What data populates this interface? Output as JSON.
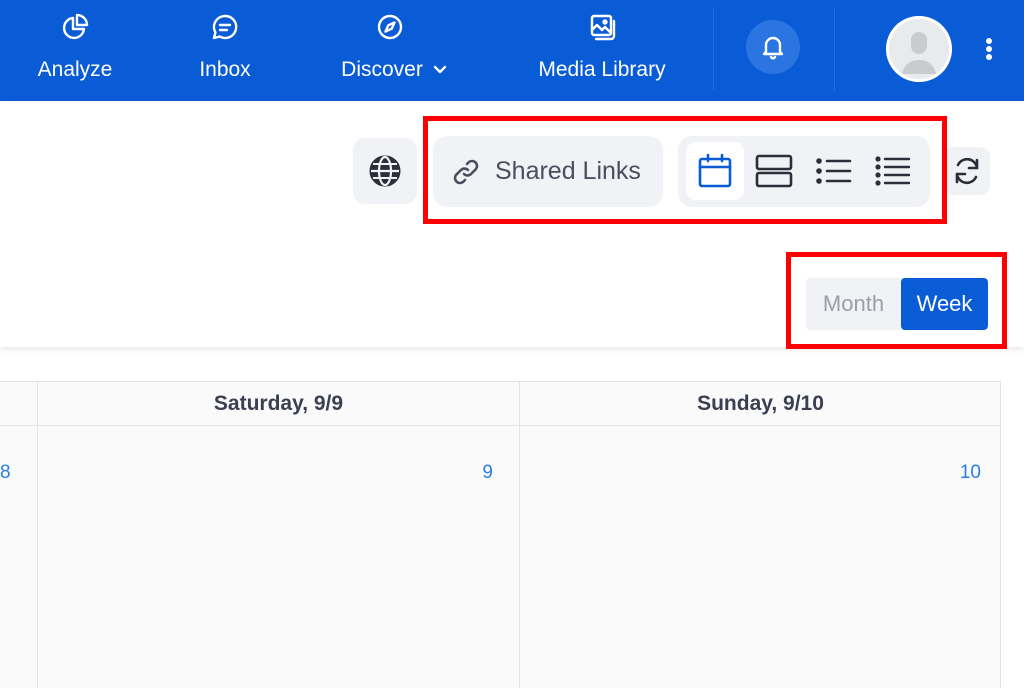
{
  "nav": {
    "items": [
      {
        "label": "Analyze",
        "icon": "pie-chart-icon"
      },
      {
        "label": "Inbox",
        "icon": "chat-bubble-icon"
      },
      {
        "label": "Discover",
        "icon": "compass-icon"
      },
      {
        "label": "Media Library",
        "icon": "image-gallery-icon"
      }
    ]
  },
  "toolbar": {
    "shared_links_label": "Shared Links"
  },
  "view_toggle": {
    "month_label": "Month",
    "week_label": "Week",
    "selected": "Week"
  },
  "calendar": {
    "prev_day_number": "8",
    "days": [
      {
        "header": "Saturday, 9/9",
        "number": "9"
      },
      {
        "header": "Sunday, 9/10",
        "number": "10"
      }
    ]
  },
  "colors": {
    "brand": "#0a5bd6",
    "highlight": "#ff0000",
    "date_link": "#2a7ee0"
  }
}
